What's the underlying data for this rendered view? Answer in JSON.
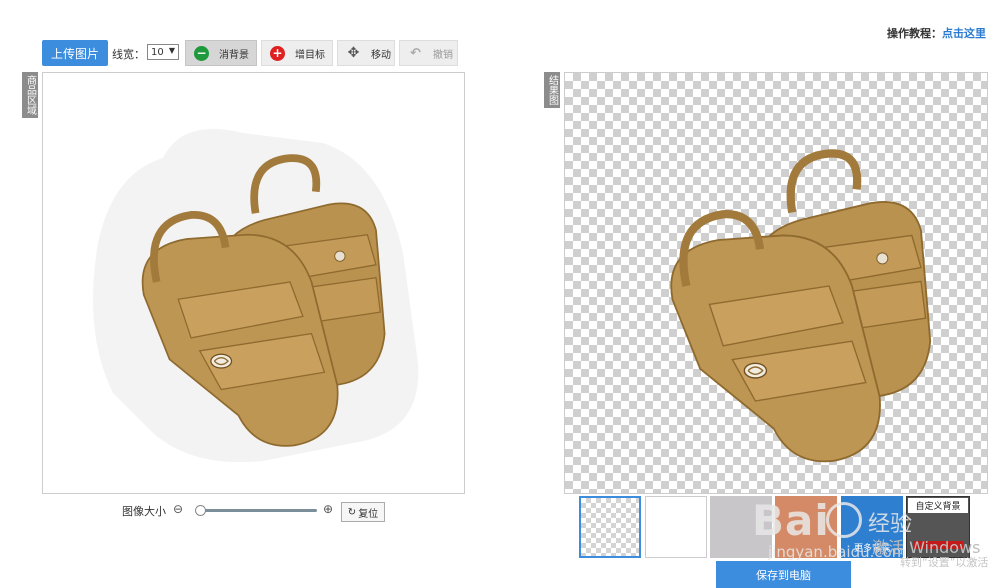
{
  "toolbar": {
    "upload_label": "上传图片",
    "line_width_label": "线宽：",
    "line_width_value": "10",
    "erase_bg_label": "消背景",
    "add_target_label": "增目标",
    "move_label": "移动",
    "undo_label": "撤销"
  },
  "tutorial": {
    "label": "操作教程：",
    "link": "点击这里"
  },
  "left_panel": {
    "tab_label": "商品区域"
  },
  "right_panel": {
    "tab_label": "结果图"
  },
  "zoom": {
    "label": "图像大小",
    "value": 0.03,
    "reset_label": "复位"
  },
  "backgrounds": {
    "more_label": "更多背景",
    "custom_label": "自定义背景"
  },
  "save_label": "保存到电脑",
  "watermark": {
    "line1": "Bai",
    "line2": "经验",
    "line3": "jingyan.baidu.com",
    "os_line1": "激活 Windows",
    "os_line2": "转到“设置”以激活"
  },
  "colors": {
    "accent": "#3c8dde",
    "erase_icon": "#1e9a3c",
    "add_icon": "#e02020",
    "sandal": "#b48a4a"
  }
}
